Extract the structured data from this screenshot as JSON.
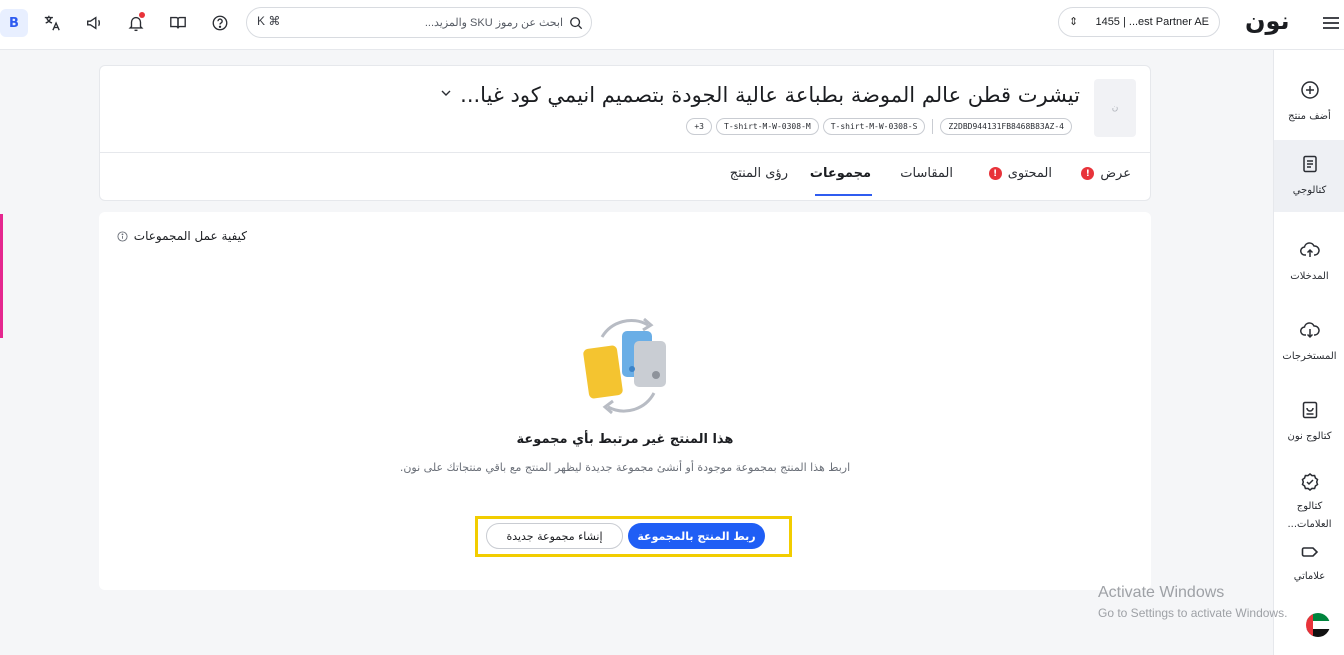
{
  "colors": {
    "accent": "#1f5ef5",
    "error": "#e8333a",
    "highlight": "#f2cd00",
    "pink": "#e5278f"
  },
  "topbar": {
    "user_initial": "B",
    "search_shortcut": "K ⌘",
    "search_placeholder": "ابحث عن رموز SKU والمزيد...",
    "partner": "1455 | ...est Partner AE",
    "logo": "نون"
  },
  "sidebar": {
    "items": [
      {
        "label": "أضف منتج",
        "icon": "plus-circle-icon"
      },
      {
        "label": "كتالوجي",
        "icon": "catalog-icon",
        "active": true
      },
      {
        "label": "المدخلات",
        "icon": "upload-cloud-icon"
      },
      {
        "label": "المستخرجات",
        "icon": "download-cloud-icon"
      },
      {
        "label": "كتالوج نون",
        "icon": "book-icon"
      },
      {
        "label_line1": "كتالوج",
        "label_line2": "العلامات...",
        "icon": "verified-badge-icon"
      },
      {
        "label": "علاماتي",
        "icon": "tag-icon"
      }
    ]
  },
  "product": {
    "thumb_text": "ن",
    "title": "تيشرت قطن عالم الموضة بطباعة عالية الجودة بتصميم انيمي كود غيا...",
    "chips": [
      "Z2DBD944131FB8468B83AZ-4",
      "T-shirt-M-W-0308-S",
      "T-shirt-M-W-0308-M",
      "+3"
    ]
  },
  "tabs": [
    {
      "label": "عرض",
      "error": true
    },
    {
      "label": "المحتوى",
      "error": true
    },
    {
      "label": "المقاسات"
    },
    {
      "label": "مجموعات",
      "active": true
    },
    {
      "label": "رؤى المنتج"
    }
  ],
  "groups": {
    "how_it_works": "كيفية عمل المجموعات",
    "empty_title": "هذا المنتج غير مرتبط بأي مجموعة",
    "empty_subtitle": "اربط هذا المنتج بمجموعة موجودة أو أنشئ مجموعة جديدة ليظهر المنتج مع باقي منتجاتك على نون.",
    "link_button": "ربط المنتج بالمجموعة",
    "create_button": "إنشاء مجموعة جديدة"
  },
  "watermark": {
    "title": "Activate Windows",
    "subtitle": "Go to Settings to activate Windows."
  }
}
